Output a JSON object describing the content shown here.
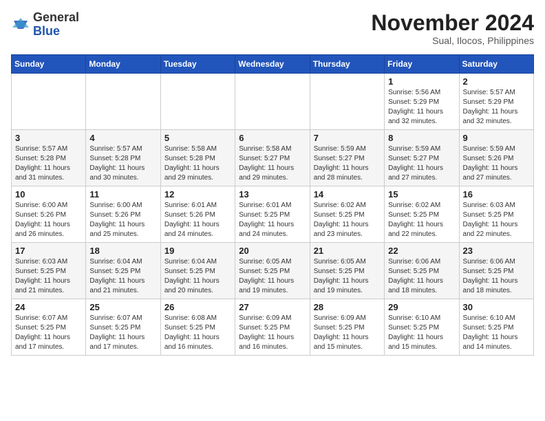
{
  "header": {
    "logo_line1": "General",
    "logo_line2": "Blue",
    "month": "November 2024",
    "location": "Sual, Ilocos, Philippines"
  },
  "weekdays": [
    "Sunday",
    "Monday",
    "Tuesday",
    "Wednesday",
    "Thursday",
    "Friday",
    "Saturday"
  ],
  "weeks": [
    [
      {
        "day": "",
        "info": ""
      },
      {
        "day": "",
        "info": ""
      },
      {
        "day": "",
        "info": ""
      },
      {
        "day": "",
        "info": ""
      },
      {
        "day": "",
        "info": ""
      },
      {
        "day": "1",
        "info": "Sunrise: 5:56 AM\nSunset: 5:29 PM\nDaylight: 11 hours\nand 32 minutes."
      },
      {
        "day": "2",
        "info": "Sunrise: 5:57 AM\nSunset: 5:29 PM\nDaylight: 11 hours\nand 32 minutes."
      }
    ],
    [
      {
        "day": "3",
        "info": "Sunrise: 5:57 AM\nSunset: 5:28 PM\nDaylight: 11 hours\nand 31 minutes."
      },
      {
        "day": "4",
        "info": "Sunrise: 5:57 AM\nSunset: 5:28 PM\nDaylight: 11 hours\nand 30 minutes."
      },
      {
        "day": "5",
        "info": "Sunrise: 5:58 AM\nSunset: 5:28 PM\nDaylight: 11 hours\nand 29 minutes."
      },
      {
        "day": "6",
        "info": "Sunrise: 5:58 AM\nSunset: 5:27 PM\nDaylight: 11 hours\nand 29 minutes."
      },
      {
        "day": "7",
        "info": "Sunrise: 5:59 AM\nSunset: 5:27 PM\nDaylight: 11 hours\nand 28 minutes."
      },
      {
        "day": "8",
        "info": "Sunrise: 5:59 AM\nSunset: 5:27 PM\nDaylight: 11 hours\nand 27 minutes."
      },
      {
        "day": "9",
        "info": "Sunrise: 5:59 AM\nSunset: 5:26 PM\nDaylight: 11 hours\nand 27 minutes."
      }
    ],
    [
      {
        "day": "10",
        "info": "Sunrise: 6:00 AM\nSunset: 5:26 PM\nDaylight: 11 hours\nand 26 minutes."
      },
      {
        "day": "11",
        "info": "Sunrise: 6:00 AM\nSunset: 5:26 PM\nDaylight: 11 hours\nand 25 minutes."
      },
      {
        "day": "12",
        "info": "Sunrise: 6:01 AM\nSunset: 5:26 PM\nDaylight: 11 hours\nand 24 minutes."
      },
      {
        "day": "13",
        "info": "Sunrise: 6:01 AM\nSunset: 5:25 PM\nDaylight: 11 hours\nand 24 minutes."
      },
      {
        "day": "14",
        "info": "Sunrise: 6:02 AM\nSunset: 5:25 PM\nDaylight: 11 hours\nand 23 minutes."
      },
      {
        "day": "15",
        "info": "Sunrise: 6:02 AM\nSunset: 5:25 PM\nDaylight: 11 hours\nand 22 minutes."
      },
      {
        "day": "16",
        "info": "Sunrise: 6:03 AM\nSunset: 5:25 PM\nDaylight: 11 hours\nand 22 minutes."
      }
    ],
    [
      {
        "day": "17",
        "info": "Sunrise: 6:03 AM\nSunset: 5:25 PM\nDaylight: 11 hours\nand 21 minutes."
      },
      {
        "day": "18",
        "info": "Sunrise: 6:04 AM\nSunset: 5:25 PM\nDaylight: 11 hours\nand 21 minutes."
      },
      {
        "day": "19",
        "info": "Sunrise: 6:04 AM\nSunset: 5:25 PM\nDaylight: 11 hours\nand 20 minutes."
      },
      {
        "day": "20",
        "info": "Sunrise: 6:05 AM\nSunset: 5:25 PM\nDaylight: 11 hours\nand 19 minutes."
      },
      {
        "day": "21",
        "info": "Sunrise: 6:05 AM\nSunset: 5:25 PM\nDaylight: 11 hours\nand 19 minutes."
      },
      {
        "day": "22",
        "info": "Sunrise: 6:06 AM\nSunset: 5:25 PM\nDaylight: 11 hours\nand 18 minutes."
      },
      {
        "day": "23",
        "info": "Sunrise: 6:06 AM\nSunset: 5:25 PM\nDaylight: 11 hours\nand 18 minutes."
      }
    ],
    [
      {
        "day": "24",
        "info": "Sunrise: 6:07 AM\nSunset: 5:25 PM\nDaylight: 11 hours\nand 17 minutes."
      },
      {
        "day": "25",
        "info": "Sunrise: 6:07 AM\nSunset: 5:25 PM\nDaylight: 11 hours\nand 17 minutes."
      },
      {
        "day": "26",
        "info": "Sunrise: 6:08 AM\nSunset: 5:25 PM\nDaylight: 11 hours\nand 16 minutes."
      },
      {
        "day": "27",
        "info": "Sunrise: 6:09 AM\nSunset: 5:25 PM\nDaylight: 11 hours\nand 16 minutes."
      },
      {
        "day": "28",
        "info": "Sunrise: 6:09 AM\nSunset: 5:25 PM\nDaylight: 11 hours\nand 15 minutes."
      },
      {
        "day": "29",
        "info": "Sunrise: 6:10 AM\nSunset: 5:25 PM\nDaylight: 11 hours\nand 15 minutes."
      },
      {
        "day": "30",
        "info": "Sunrise: 6:10 AM\nSunset: 5:25 PM\nDaylight: 11 hours\nand 14 minutes."
      }
    ]
  ]
}
